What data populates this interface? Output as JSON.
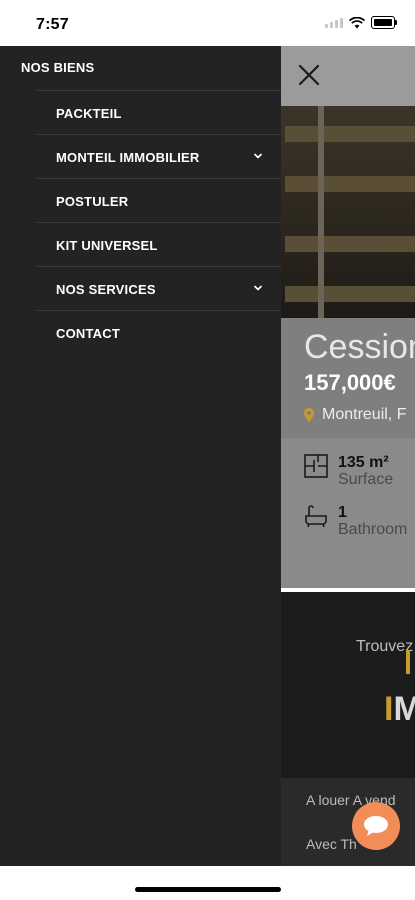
{
  "status_bar": {
    "time": "7:57"
  },
  "drawer": {
    "root_label": "NOS BIENS",
    "items": [
      {
        "label": "PACKTEIL",
        "has_submenu": false
      },
      {
        "label": "MONTEIL IMMOBILIER",
        "has_submenu": true
      },
      {
        "label": "POSTULER",
        "has_submenu": false
      },
      {
        "label": "KIT UNIVERSEL",
        "has_submenu": false
      },
      {
        "label": "NOS SERVICES",
        "has_submenu": true
      },
      {
        "label": "CONTACT",
        "has_submenu": false
      }
    ]
  },
  "listing": {
    "title": "Cession",
    "price": "157,000€",
    "location": "Montreuil, F",
    "surface_value": "135 m²",
    "surface_label": "Surface",
    "bathroom_value": "1",
    "bathroom_label": "Bathroom"
  },
  "promo": {
    "trouvez": "Trouvez",
    "im_i": "I",
    "im_m": "M",
    "tabs": "A louer   A vend",
    "avec": "Avec Th"
  },
  "colors": {
    "drawer_bg": "#232323",
    "accent": "#c99a2e",
    "chat_fab": "#f28d5a"
  }
}
